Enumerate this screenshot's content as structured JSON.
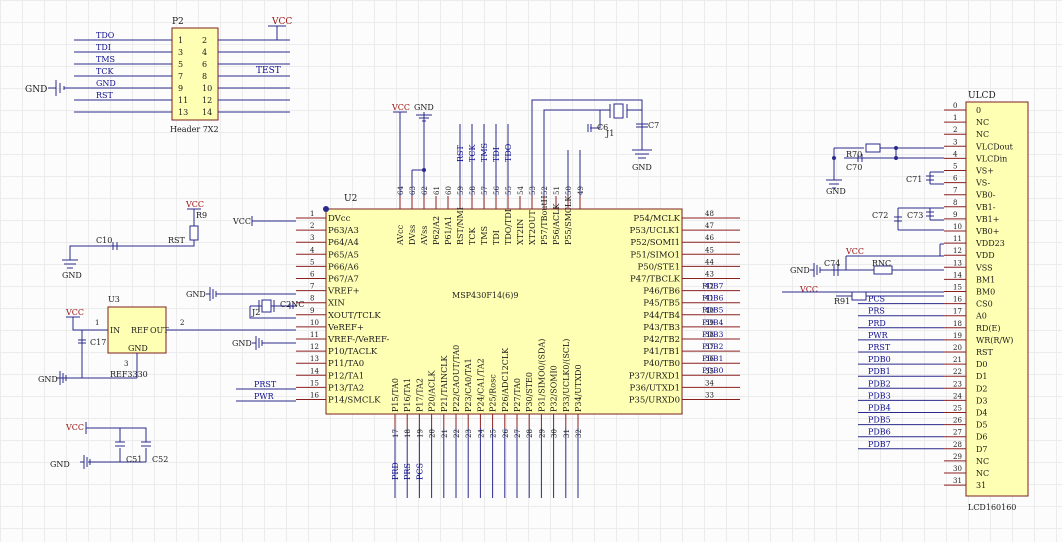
{
  "p2": {
    "ref": "P2",
    "caption": "Header 7X2",
    "left_nets": [
      "TDO",
      "TDI",
      "TMS",
      "TCK",
      "GND",
      "RST",
      "",
      ""
    ],
    "pins": [
      [
        "1",
        "2"
      ],
      [
        "3",
        "4"
      ],
      [
        "5",
        "6"
      ],
      [
        "7",
        "8"
      ],
      [
        "9",
        "10"
      ],
      [
        "11",
        "12"
      ],
      [
        "13",
        "14"
      ]
    ],
    "vcc": "VCC",
    "test": "TEST",
    "gnd": "GND"
  },
  "u2": {
    "ref": "U2",
    "name": "MSP430F14(6)9",
    "left": [
      [
        "1",
        "DVcc"
      ],
      [
        "2",
        "P63/A3"
      ],
      [
        "3",
        "P64/A4"
      ],
      [
        "4",
        "P65/A5"
      ],
      [
        "5",
        "P66/A6"
      ],
      [
        "6",
        "P67/A7"
      ],
      [
        "7",
        "VREF+"
      ],
      [
        "8",
        "XIN"
      ],
      [
        "9",
        "XOUT/TCLK"
      ],
      [
        "10",
        "VeREF+"
      ],
      [
        "11",
        "VREF-/VeREF-"
      ],
      [
        "12",
        "P10/TACLK"
      ],
      [
        "13",
        "P11/TA0"
      ],
      [
        "14",
        "P12/TA1"
      ],
      [
        "15",
        "P13/TA2"
      ],
      [
        "16",
        "P14/SMCLK"
      ]
    ],
    "right": [
      [
        "48",
        "P54/MCLK"
      ],
      [
        "47",
        "P53/UCLK1"
      ],
      [
        "46",
        "P52/SOMI1"
      ],
      [
        "45",
        "P51/SIMO1"
      ],
      [
        "44",
        "P50/STE1"
      ],
      [
        "43",
        "P47/TBCLK"
      ],
      [
        "42",
        "P46/TB6"
      ],
      [
        "41",
        "P45/TB5"
      ],
      [
        "40",
        "P44/TB4"
      ],
      [
        "39",
        "P43/TB3"
      ],
      [
        "38",
        "P42/TB2"
      ],
      [
        "37",
        "P41/TB1"
      ],
      [
        "36",
        "P40/TB0"
      ],
      [
        "35",
        "P37/URXD1"
      ],
      [
        "34",
        "P36/UTXD1"
      ],
      [
        "33",
        "P35/URXD0"
      ]
    ],
    "top": [
      [
        "64",
        "AVcc"
      ],
      [
        "63",
        "DVss"
      ],
      [
        "62",
        "AVss"
      ],
      [
        "61",
        "P62/A2"
      ],
      [
        "60",
        "P61/A1"
      ],
      [
        "59",
        "RST/NMI"
      ],
      [
        "58",
        "TCK"
      ],
      [
        "57",
        "TMS"
      ],
      [
        "56",
        "TDI"
      ],
      [
        "55",
        "TDO/TDI"
      ],
      [
        "54",
        "XT2IN"
      ],
      [
        "53",
        "XT2OUT"
      ],
      [
        "52",
        "P57/TBoutH"
      ],
      [
        "51",
        "P56/ACLK"
      ],
      [
        "50",
        "P55/SMCLK"
      ],
      [
        "49",
        ""
      ]
    ],
    "bottom": [
      [
        "17",
        "P15/TA0"
      ],
      [
        "18",
        "P16/TA1"
      ],
      [
        "19",
        "P17/TA2"
      ],
      [
        "20",
        "P20/ACLK"
      ],
      [
        "21",
        "P21/TAINCLK"
      ],
      [
        "22",
        "P22/CAOUT/TA0"
      ],
      [
        "23",
        "P23/CA0/TA1"
      ],
      [
        "24",
        "P24/CA1/TA2"
      ],
      [
        "25",
        "P25/Rosc"
      ],
      [
        "26",
        "P26/ADC12CLK"
      ],
      [
        "27",
        "P27/TA0"
      ],
      [
        "28",
        "P30/STE0"
      ],
      [
        "29",
        "P31/SIMO0/(SDA)"
      ],
      [
        "30",
        "P32/SOMI0"
      ],
      [
        "31",
        "P33/UCLK0/(SCL)"
      ],
      [
        "32",
        "P34/UTXD0"
      ]
    ],
    "right_nets": [
      "",
      "",
      "",
      "",
      "",
      "PDB7",
      "PDB6",
      "PDB5",
      "PDB4",
      "PDB3",
      "PDB2",
      "PDB1",
      "PDB0",
      "",
      "",
      ""
    ],
    "top_nets": [
      "VCC",
      "GND",
      "",
      "",
      "",
      "RST",
      "TCK",
      "TMS",
      "TDI",
      "TDO",
      "",
      "",
      "",
      "",
      "",
      ""
    ],
    "bottom_nets": [
      "PRD",
      "PRS",
      "PCS"
    ],
    "left_nets": {
      "vcc": "VCC",
      "gnd": "GND",
      "gnd2": "GND",
      "prst": "PRST",
      "pwr": "PWR"
    }
  },
  "ulcd": {
    "ref": "ULCD",
    "caption": "LCD160160",
    "pins": [
      [
        "0",
        "0"
      ],
      [
        "1",
        "NC"
      ],
      [
        "2",
        "NC"
      ],
      [
        "3",
        "VLCDout"
      ],
      [
        "4",
        "VLCDin"
      ],
      [
        "5",
        "VS+"
      ],
      [
        "6",
        "VS-"
      ],
      [
        "7",
        "VB0-"
      ],
      [
        "8",
        "VB1-"
      ],
      [
        "9",
        "VB1+"
      ],
      [
        "10",
        "VB0+"
      ],
      [
        "11",
        "VDD23"
      ],
      [
        "12",
        "VDD"
      ],
      [
        "13",
        "VSS"
      ],
      [
        "14",
        "BM1"
      ],
      [
        "15",
        "BM0"
      ],
      [
        "16",
        "CS0"
      ],
      [
        "17",
        "A0"
      ],
      [
        "18",
        "RD(E)"
      ],
      [
        "19",
        "WR(R/W)"
      ],
      [
        "20",
        "RST"
      ],
      [
        "21",
        "D0"
      ],
      [
        "22",
        "D1"
      ],
      [
        "23",
        "D2"
      ],
      [
        "24",
        "D3"
      ],
      [
        "25",
        "D4"
      ],
      [
        "26",
        "D5"
      ],
      [
        "27",
        "D6"
      ],
      [
        "28",
        "D7"
      ],
      [
        "29",
        "NC"
      ],
      [
        "30",
        "NC"
      ],
      [
        "31",
        "31"
      ]
    ],
    "left_nets": {
      "16": "PCS",
      "17": "PRS",
      "18": "PRD",
      "19": "PWR",
      "20": "PRST",
      "21": "PDB0",
      "22": "PDB1",
      "23": "PDB2",
      "24": "PDB3",
      "25": "PDB4",
      "26": "PDB5",
      "27": "PDB6",
      "28": "PDB7"
    }
  },
  "parts": {
    "r70": "R70",
    "c70": "C70",
    "c71": "C71",
    "c72": "C72",
    "c73": "C73",
    "c74": "C74",
    "rnc": "RNC",
    "r91": "R91",
    "r9": "R9",
    "c10": "C10",
    "c6": "C6",
    "c7": "C7",
    "j1": "J1",
    "j2": "J2",
    "c2nc": "C2NC",
    "c17": "C17",
    "c51": "C51",
    "c52": "C52",
    "u3": "U3",
    "u3name": "REF3330",
    "u3in": "IN",
    "u3ref": "REF",
    "u3out": "OUT",
    "u3gnd": "GND",
    "u3p1": "1",
    "u3p2": "2",
    "u3p3": "3"
  },
  "nets": {
    "vcc": "VCC",
    "gnd": "GND",
    "rst": "RST"
  },
  "colors": {
    "wire": "#2a2a8c",
    "body": "#8b2020",
    "chip_fill": "#ffffb4",
    "net_text": "#101090"
  }
}
